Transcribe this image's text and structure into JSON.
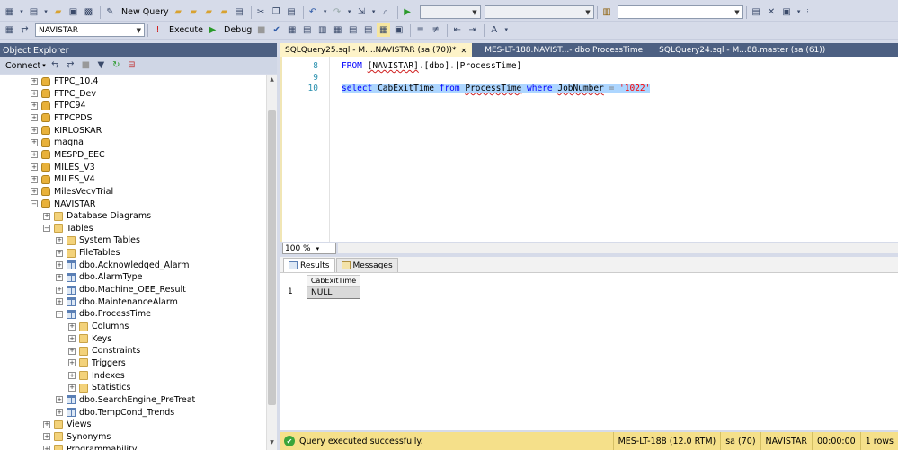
{
  "toolbar1": {
    "new_query_label": "New Query",
    "icons": [
      "new-project-icon",
      "add-item-icon",
      "open-file-icon",
      "save-icon",
      "save-all-icon",
      "new-query-icon",
      "db-engine-query-icon",
      "analysis-query-icon",
      "mdx-query-icon",
      "dmx-query-icon",
      "xmla-query-icon",
      "cut-icon",
      "copy-icon",
      "paste-icon",
      "undo-icon",
      "redo-icon",
      "navigate-icon",
      "find-icon",
      "start-debug-icon",
      "properties-icon",
      "template-icon",
      "toolbox-icon",
      "settings-icon"
    ]
  },
  "toolbar2": {
    "database_value": "NAVISTAR",
    "execute_label": "Execute",
    "debug_label": "Debug"
  },
  "object_explorer": {
    "title": "Object Explorer",
    "connect_label": "Connect",
    "tree": [
      {
        "label": "FTPC_10.4",
        "icon": "database-icon",
        "level": 0,
        "expanded": false
      },
      {
        "label": "FTPC_Dev",
        "icon": "database-icon",
        "level": 0,
        "expanded": false
      },
      {
        "label": "FTPC94",
        "icon": "database-icon",
        "level": 0,
        "expanded": false
      },
      {
        "label": "FTPCPDS",
        "icon": "database-icon",
        "level": 0,
        "expanded": false
      },
      {
        "label": "KIRLOSKAR",
        "icon": "database-icon",
        "level": 0,
        "expanded": false
      },
      {
        "label": "magna",
        "icon": "database-icon",
        "level": 0,
        "expanded": false
      },
      {
        "label": "MESPD_EEC",
        "icon": "database-icon",
        "level": 0,
        "expanded": false
      },
      {
        "label": "MILES_V3",
        "icon": "database-icon",
        "level": 0,
        "expanded": false
      },
      {
        "label": "MILES_V4",
        "icon": "database-icon",
        "level": 0,
        "expanded": false
      },
      {
        "label": "MilesVecvTrial",
        "icon": "database-icon",
        "level": 0,
        "expanded": false
      },
      {
        "label": "NAVISTAR",
        "icon": "database-icon",
        "level": 0,
        "expanded": true
      },
      {
        "label": "Database Diagrams",
        "icon": "folder-icon",
        "level": 1,
        "expanded": false
      },
      {
        "label": "Tables",
        "icon": "folder-icon",
        "level": 1,
        "expanded": true
      },
      {
        "label": "System Tables",
        "icon": "folder-icon",
        "level": 2,
        "expanded": false
      },
      {
        "label": "FileTables",
        "icon": "folder-icon",
        "level": 2,
        "expanded": false
      },
      {
        "label": "dbo.Acknowledged_Alarm",
        "icon": "table-icon",
        "level": 2,
        "expanded": false
      },
      {
        "label": "dbo.AlarmType",
        "icon": "table-icon",
        "level": 2,
        "expanded": false
      },
      {
        "label": "dbo.Machine_OEE_Result",
        "icon": "table-icon",
        "level": 2,
        "expanded": false
      },
      {
        "label": "dbo.MaintenanceAlarm",
        "icon": "table-icon",
        "level": 2,
        "expanded": false
      },
      {
        "label": "dbo.ProcessTime",
        "icon": "table-icon",
        "level": 2,
        "expanded": true
      },
      {
        "label": "Columns",
        "icon": "folder-icon",
        "level": 3,
        "expanded": false
      },
      {
        "label": "Keys",
        "icon": "folder-icon",
        "level": 3,
        "expanded": false
      },
      {
        "label": "Constraints",
        "icon": "folder-icon",
        "level": 3,
        "expanded": false
      },
      {
        "label": "Triggers",
        "icon": "folder-icon",
        "level": 3,
        "expanded": false
      },
      {
        "label": "Indexes",
        "icon": "folder-icon",
        "level": 3,
        "expanded": false
      },
      {
        "label": "Statistics",
        "icon": "folder-icon",
        "level": 3,
        "expanded": false
      },
      {
        "label": "dbo.SearchEngine_PreTreat",
        "icon": "table-icon",
        "level": 2,
        "expanded": false
      },
      {
        "label": "dbo.TempCond_Trends",
        "icon": "table-icon",
        "level": 2,
        "expanded": false
      },
      {
        "label": "Views",
        "icon": "folder-icon",
        "level": 1,
        "expanded": false
      },
      {
        "label": "Synonyms",
        "icon": "folder-icon",
        "level": 1,
        "expanded": false
      },
      {
        "label": "Programmability",
        "icon": "folder-icon",
        "level": 1,
        "expanded": false
      }
    ]
  },
  "tabs": [
    {
      "label": "SQLQuery25.sql - M....NAVISTAR (sa (70))*",
      "close": "✕",
      "active": true
    },
    {
      "label": "MES-LT-188.NAVIST...- dbo.ProcessTime",
      "active": false
    },
    {
      "label": "SQLQuery24.sql - M...88.master (sa (61))",
      "active": false
    }
  ],
  "editor": {
    "line_numbers": [
      "8",
      "9",
      "10"
    ],
    "line8": {
      "kw": "FROM",
      "schema": "[NAVISTAR]",
      "dot1": ".",
      "dbo": "[dbo]",
      "dot2": ".",
      "table": "[ProcessTime]"
    },
    "line10": {
      "select": "select",
      "col": "CabExitTime",
      "from": "from",
      "table": "ProcessTime",
      "where": "where",
      "field": "JobNumber",
      "eq": "=",
      "value": "'1022'"
    },
    "zoom": "100 %"
  },
  "results": {
    "tab_results": "Results",
    "tab_messages": "Messages",
    "column_header": "CabExitTime",
    "row_number": "1",
    "cell_value": "NULL"
  },
  "status": {
    "message": "Query executed successfully.",
    "server": "MES-LT-188 (12.0 RTM)",
    "user": "sa (70)",
    "database": "NAVISTAR",
    "time": "00:00:00",
    "rows": "1 rows"
  },
  "colors": {
    "panel_title": "#4d6082",
    "status_bar": "#f5e08a",
    "selection": "#add6ff",
    "keyword": "#0000ff",
    "string": "#ff0000"
  }
}
